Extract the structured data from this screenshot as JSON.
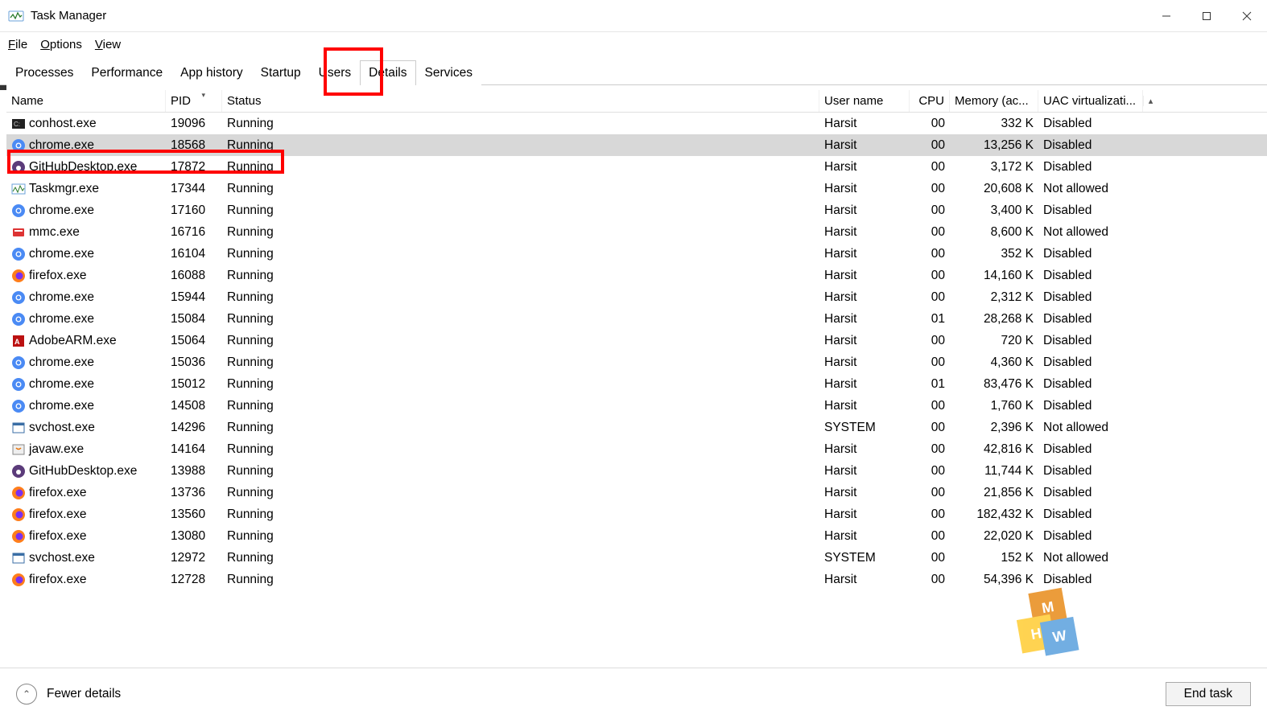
{
  "window": {
    "title": "Task Manager"
  },
  "menu": {
    "file": "File",
    "options": "Options",
    "view": "View"
  },
  "tabs": [
    "Processes",
    "Performance",
    "App history",
    "Startup",
    "Users",
    "Details",
    "Services"
  ],
  "active_tab": "Details",
  "columns": {
    "name": "Name",
    "pid": "PID",
    "status": "Status",
    "user": "User name",
    "cpu": "CPU",
    "mem": "Memory (ac...",
    "uac": "UAC virtualizati..."
  },
  "rows": [
    {
      "icon": "console",
      "name": "conhost.exe",
      "pid": "19096",
      "status": "Running",
      "user": "Harsit",
      "cpu": "00",
      "mem": "332 K",
      "uac": "Disabled",
      "sel": false
    },
    {
      "icon": "chrome",
      "name": "chrome.exe",
      "pid": "18568",
      "status": "Running",
      "user": "Harsit",
      "cpu": "00",
      "mem": "13,256 K",
      "uac": "Disabled",
      "sel": true
    },
    {
      "icon": "github",
      "name": "GitHubDesktop.exe",
      "pid": "17872",
      "status": "Running",
      "user": "Harsit",
      "cpu": "00",
      "mem": "3,172 K",
      "uac": "Disabled",
      "sel": false
    },
    {
      "icon": "taskmgr",
      "name": "Taskmgr.exe",
      "pid": "17344",
      "status": "Running",
      "user": "Harsit",
      "cpu": "00",
      "mem": "20,608 K",
      "uac": "Not allowed",
      "sel": false
    },
    {
      "icon": "chrome",
      "name": "chrome.exe",
      "pid": "17160",
      "status": "Running",
      "user": "Harsit",
      "cpu": "00",
      "mem": "3,400 K",
      "uac": "Disabled",
      "sel": false
    },
    {
      "icon": "mmc",
      "name": "mmc.exe",
      "pid": "16716",
      "status": "Running",
      "user": "Harsit",
      "cpu": "00",
      "mem": "8,600 K",
      "uac": "Not allowed",
      "sel": false
    },
    {
      "icon": "chrome",
      "name": "chrome.exe",
      "pid": "16104",
      "status": "Running",
      "user": "Harsit",
      "cpu": "00",
      "mem": "352 K",
      "uac": "Disabled",
      "sel": false
    },
    {
      "icon": "firefox",
      "name": "firefox.exe",
      "pid": "16088",
      "status": "Running",
      "user": "Harsit",
      "cpu": "00",
      "mem": "14,160 K",
      "uac": "Disabled",
      "sel": false
    },
    {
      "icon": "chrome",
      "name": "chrome.exe",
      "pid": "15944",
      "status": "Running",
      "user": "Harsit",
      "cpu": "00",
      "mem": "2,312 K",
      "uac": "Disabled",
      "sel": false
    },
    {
      "icon": "chrome",
      "name": "chrome.exe",
      "pid": "15084",
      "status": "Running",
      "user": "Harsit",
      "cpu": "01",
      "mem": "28,268 K",
      "uac": "Disabled",
      "sel": false
    },
    {
      "icon": "adobe",
      "name": "AdobeARM.exe",
      "pid": "15064",
      "status": "Running",
      "user": "Harsit",
      "cpu": "00",
      "mem": "720 K",
      "uac": "Disabled",
      "sel": false
    },
    {
      "icon": "chrome",
      "name": "chrome.exe",
      "pid": "15036",
      "status": "Running",
      "user": "Harsit",
      "cpu": "00",
      "mem": "4,360 K",
      "uac": "Disabled",
      "sel": false
    },
    {
      "icon": "chrome",
      "name": "chrome.exe",
      "pid": "15012",
      "status": "Running",
      "user": "Harsit",
      "cpu": "01",
      "mem": "83,476 K",
      "uac": "Disabled",
      "sel": false
    },
    {
      "icon": "chrome",
      "name": "chrome.exe",
      "pid": "14508",
      "status": "Running",
      "user": "Harsit",
      "cpu": "00",
      "mem": "1,760 K",
      "uac": "Disabled",
      "sel": false
    },
    {
      "icon": "svchost",
      "name": "svchost.exe",
      "pid": "14296",
      "status": "Running",
      "user": "SYSTEM",
      "cpu": "00",
      "mem": "2,396 K",
      "uac": "Not allowed",
      "sel": false
    },
    {
      "icon": "java",
      "name": "javaw.exe",
      "pid": "14164",
      "status": "Running",
      "user": "Harsit",
      "cpu": "00",
      "mem": "42,816 K",
      "uac": "Disabled",
      "sel": false
    },
    {
      "icon": "github",
      "name": "GitHubDesktop.exe",
      "pid": "13988",
      "status": "Running",
      "user": "Harsit",
      "cpu": "00",
      "mem": "11,744 K",
      "uac": "Disabled",
      "sel": false
    },
    {
      "icon": "firefox",
      "name": "firefox.exe",
      "pid": "13736",
      "status": "Running",
      "user": "Harsit",
      "cpu": "00",
      "mem": "21,856 K",
      "uac": "Disabled",
      "sel": false
    },
    {
      "icon": "firefox",
      "name": "firefox.exe",
      "pid": "13560",
      "status": "Running",
      "user": "Harsit",
      "cpu": "00",
      "mem": "182,432 K",
      "uac": "Disabled",
      "sel": false
    },
    {
      "icon": "firefox",
      "name": "firefox.exe",
      "pid": "13080",
      "status": "Running",
      "user": "Harsit",
      "cpu": "00",
      "mem": "22,020 K",
      "uac": "Disabled",
      "sel": false
    },
    {
      "icon": "svchost",
      "name": "svchost.exe",
      "pid": "12972",
      "status": "Running",
      "user": "SYSTEM",
      "cpu": "00",
      "mem": "152 K",
      "uac": "Not allowed",
      "sel": false
    },
    {
      "icon": "firefox",
      "name": "firefox.exe",
      "pid": "12728",
      "status": "Running",
      "user": "Harsit",
      "cpu": "00",
      "mem": "54,396 K",
      "uac": "Disabled",
      "sel": false
    }
  ],
  "footer": {
    "fewer": "Fewer details",
    "endtask": "End task"
  }
}
